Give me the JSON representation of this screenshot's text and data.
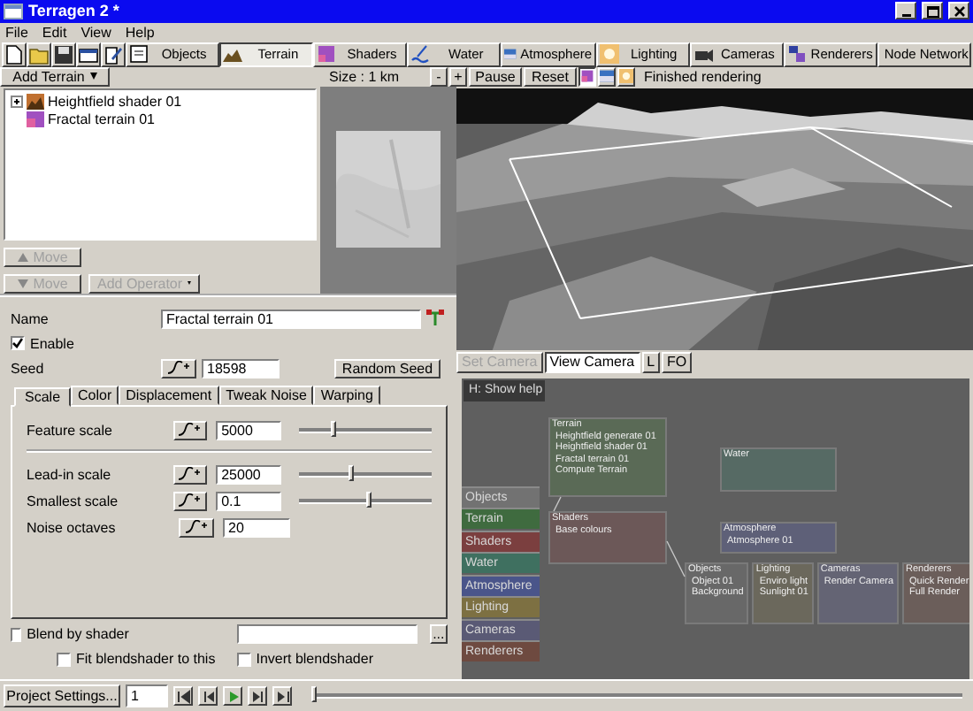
{
  "window": {
    "title": "Terragen 2 *"
  },
  "menu": [
    "File",
    "Edit",
    "View",
    "Help"
  ],
  "tabs": [
    {
      "label": "Objects",
      "selected": false
    },
    {
      "label": "Terrain",
      "selected": true
    },
    {
      "label": "Shaders",
      "selected": false
    },
    {
      "label": "Water",
      "selected": false
    },
    {
      "label": "Atmosphere",
      "selected": false
    },
    {
      "label": "Lighting",
      "selected": false
    },
    {
      "label": "Cameras",
      "selected": false
    },
    {
      "label": "Renderers",
      "selected": false
    },
    {
      "label": "Node Network",
      "selected": false
    }
  ],
  "terrain_panel": {
    "add_button": "Add Terrain",
    "tree": [
      {
        "label": "Heightfield shader 01",
        "kind": "group",
        "expanded": false
      },
      {
        "label": "Fractal terrain 01",
        "kind": "leaf"
      }
    ],
    "move_buttons": [
      {
        "label": "Move",
        "kind": "up",
        "disabled": true
      },
      {
        "label": "Move",
        "kind": "down",
        "disabled": true
      }
    ],
    "add_operator": {
      "label": "Add Operator",
      "disabled": true
    }
  },
  "viewport": {
    "size_label": "Size : 1 km",
    "zoom_buttons": [
      "-",
      "+"
    ],
    "pause_button": "Pause",
    "reset_button": "Reset",
    "view_toggles": [
      {
        "selected": true
      },
      {
        "selected": false
      },
      {
        "selected": false
      }
    ],
    "status": "Finished rendering",
    "camera_buttons": [
      {
        "label": "Set Camera",
        "disabled": true,
        "pressed": false
      },
      {
        "label": "View Camera",
        "disabled": false,
        "pressed": true
      },
      {
        "label": "L",
        "disabled": false,
        "pressed": false
      },
      {
        "label": "FO",
        "disabled": false,
        "pressed": false
      }
    ]
  },
  "properties": {
    "name_label": "Name",
    "name_value": "Fractal terrain 01",
    "enable": {
      "label": "Enable",
      "checked": true
    },
    "seed_label": "Seed",
    "seed_value": "18598",
    "random_seed_button": "Random Seed",
    "tabs": [
      {
        "label": "Scale",
        "selected": true
      },
      {
        "label": "Color",
        "selected": false
      },
      {
        "label": "Displacement",
        "selected": false
      },
      {
        "label": "Tweak Noise",
        "selected": false
      },
      {
        "label": "Warping",
        "selected": false
      }
    ],
    "param_groups": [
      [
        {
          "label": "Feature scale",
          "value": "5000",
          "kind": "slider",
          "level": 0.27
        }
      ],
      [
        {
          "label": "Lead-in scale",
          "value": "25000",
          "kind": "slider",
          "level": 0.4
        },
        {
          "label": "Smallest scale",
          "value": "0.1",
          "kind": "slider",
          "level": 0.54
        },
        {
          "label": "Noise octaves",
          "value": "20",
          "kind": "field"
        }
      ]
    ],
    "blend": {
      "label": "Blend by shader",
      "checked": false
    },
    "blend_browse_button": "...",
    "fit_blendshader": {
      "label": "Fit blendshader to this",
      "checked": false
    },
    "invert_blendshader": {
      "label": "Invert blendshader",
      "checked": false
    }
  },
  "node_network": {
    "help": "H: Show help",
    "categories": [
      {
        "label": "Objects",
        "color": "#727272"
      },
      {
        "label": "Terrain",
        "color": "#3f6b3f"
      },
      {
        "label": "Shaders",
        "color": "#7b3f3f"
      },
      {
        "label": "Water",
        "color": "#3f7060"
      },
      {
        "label": "Atmosphere",
        "color": "#4a558a"
      },
      {
        "label": "Lighting",
        "color": "#7d7042"
      },
      {
        "label": "Cameras",
        "color": "#5a5a75"
      },
      {
        "label": "Renderers",
        "color": "#6e4a40"
      }
    ],
    "groups": [
      {
        "label": "Terrain",
        "color": "#5a6a56",
        "nodes": [
          "Heightfield generate 01",
          "Heightfield shader 01",
          "Fractal terrain 01",
          "Compute Terrain"
        ]
      },
      {
        "label": "Shaders",
        "color": "#6c5858",
        "nodes": [
          "Base colours"
        ]
      },
      {
        "label": "Water",
        "color": "#566a64"
      },
      {
        "label": "Atmosphere",
        "color": "#5e6078",
        "nodes": [
          "Atmosphere 01"
        ]
      },
      {
        "label": "Objects",
        "color": "#686868",
        "nodes": [
          "Object 01",
          "Background"
        ]
      },
      {
        "label": "Lighting",
        "color": "#6b685c",
        "nodes": [
          "Enviro light",
          "Sunlight 01"
        ]
      },
      {
        "label": "Cameras",
        "color": "#646474",
        "nodes": [
          "Render Camera"
        ]
      },
      {
        "label": "Renderers",
        "color": "#6b5e5a",
        "nodes": [
          "Quick Render",
          "Full Render"
        ]
      }
    ]
  },
  "bottom_bar": {
    "project_settings_button": "Project Settings...",
    "frame": "1",
    "timeline": {
      "level": 0
    }
  }
}
